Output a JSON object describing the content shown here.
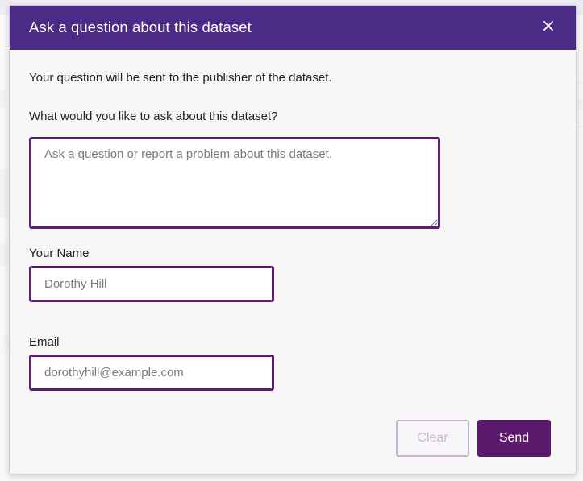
{
  "modal": {
    "title": "Ask a question about this dataset",
    "close_symbol": "×",
    "intro": "Your question will be sent to the publisher of the dataset.",
    "question_label": "What would you like to ask about this dataset?",
    "question_placeholder": "Ask a question or report a problem about this dataset.",
    "name_label": "Your Name",
    "name_placeholder": "Dorothy Hill",
    "email_label": "Email",
    "email_placeholder": "dorothyhill@example.com",
    "clear_label": "Clear",
    "send_label": "Send",
    "colors": {
      "header": "#4b2b86",
      "field_border": "#5a1f6e",
      "send_bg": "#5b1a6a",
      "clear_border": "#c9b3d4"
    }
  }
}
